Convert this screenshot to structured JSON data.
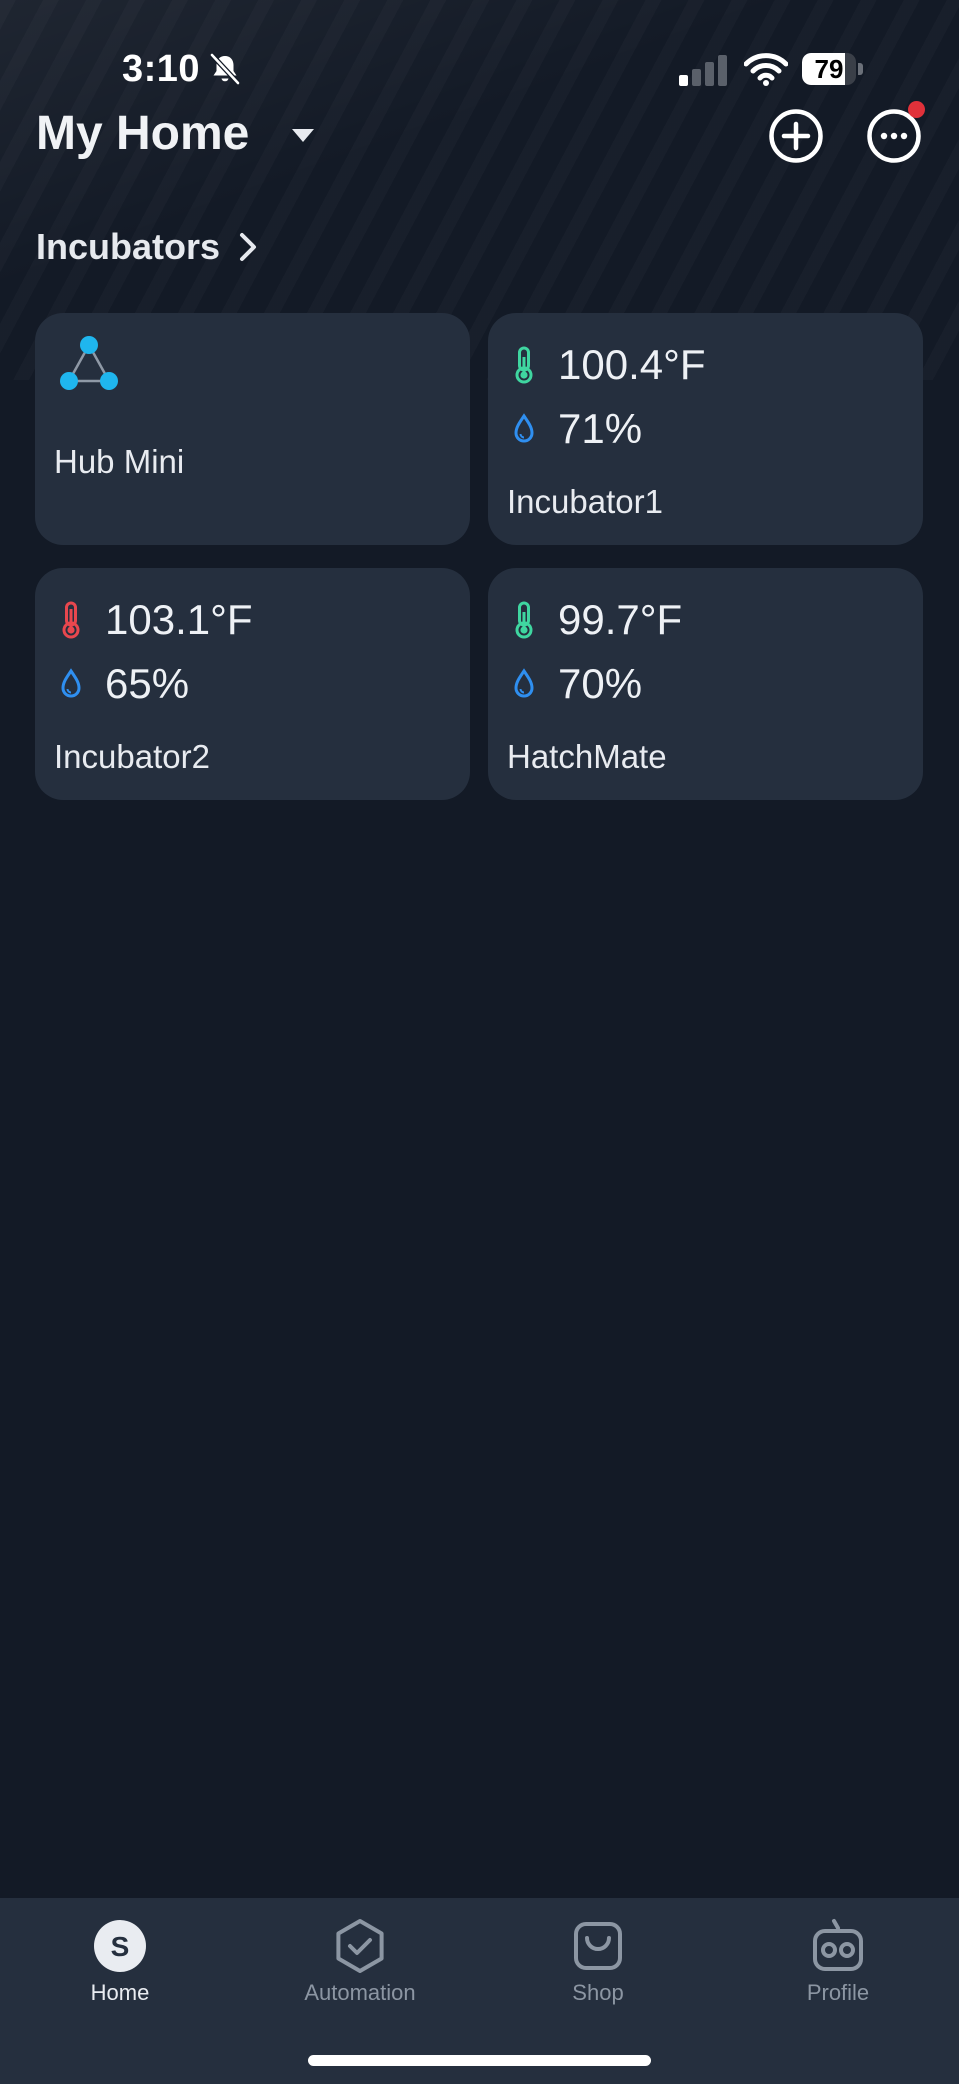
{
  "status_bar": {
    "time": "3:10",
    "battery_level": "79",
    "battery_fraction": 0.79
  },
  "header": {
    "title": "My Home",
    "add_icon": "plus-circle-icon",
    "more_icon": "ellipsis-circle-icon",
    "notification_color": "#e0313a"
  },
  "section": {
    "title": "Incubators"
  },
  "devices": [
    {
      "name": "Hub Mini",
      "icon": "hub-icon"
    },
    {
      "name": "Incubator1",
      "temperature": "100.4°F",
      "humidity": "71%",
      "temp_status_color": "#3fd6a0"
    },
    {
      "name": "Incubator2",
      "temperature": "103.1°F",
      "humidity": "65%",
      "temp_status_color": "#e8474e"
    },
    {
      "name": "HatchMate",
      "temperature": "99.7°F",
      "humidity": "70%",
      "temp_status_color": "#3fd6a0"
    }
  ],
  "colors": {
    "background": "#131a26",
    "card": "#252f3e",
    "humidity_blue": "#2f8ff0",
    "hub_accent": "#1fb6ee"
  },
  "nav": {
    "items": [
      {
        "label": "Home",
        "icon": "home-s-icon",
        "active": true
      },
      {
        "label": "Automation",
        "icon": "automation-icon",
        "active": false
      },
      {
        "label": "Shop",
        "icon": "shopping-bag-icon",
        "active": false
      },
      {
        "label": "Profile",
        "icon": "robot-profile-icon",
        "active": false
      }
    ]
  }
}
